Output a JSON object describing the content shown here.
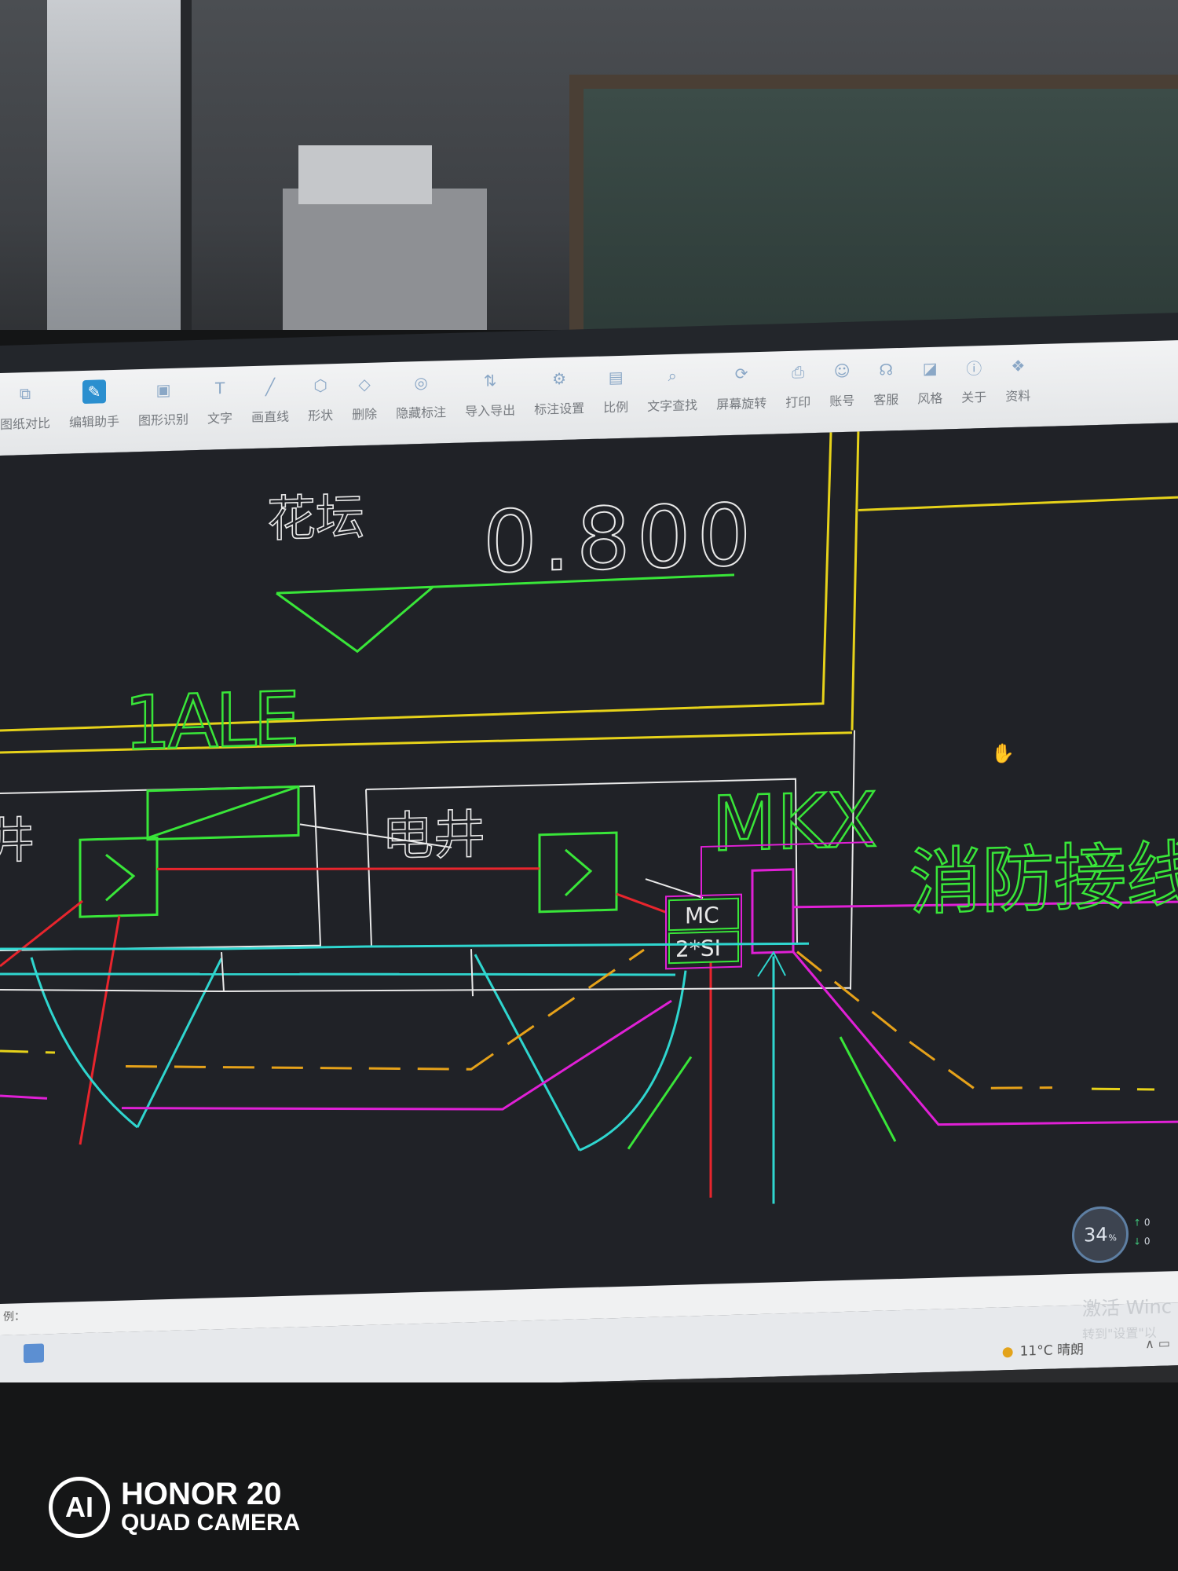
{
  "toolbar": {
    "items": [
      {
        "label": "图纸对比",
        "icon": "compare-icon"
      },
      {
        "label": "编辑助手",
        "icon": "edit-assistant-icon"
      },
      {
        "label": "图形识别",
        "icon": "shape-recognize-icon"
      },
      {
        "label": "文字",
        "icon": "text-icon"
      },
      {
        "label": "画直线",
        "icon": "line-icon"
      },
      {
        "label": "形状",
        "icon": "shape-icon"
      },
      {
        "label": "删除",
        "icon": "eraser-icon"
      },
      {
        "label": "隐藏标注",
        "icon": "hide-annotation-icon"
      },
      {
        "label": "导入导出",
        "icon": "import-export-icon"
      },
      {
        "label": "标注设置",
        "icon": "annotation-settings-icon"
      },
      {
        "label": "比例",
        "icon": "scale-icon"
      },
      {
        "label": "文字查找",
        "icon": "text-search-icon"
      },
      {
        "label": "屏幕旋转",
        "icon": "rotate-screen-icon"
      },
      {
        "label": "打印",
        "icon": "print-icon"
      },
      {
        "label": "账号",
        "icon": "account-icon"
      },
      {
        "label": "客服",
        "icon": "support-headset-icon"
      },
      {
        "label": "风格",
        "icon": "style-icon"
      },
      {
        "label": "关于",
        "icon": "info-icon"
      },
      {
        "label": "资料",
        "icon": "materials-icon"
      }
    ]
  },
  "drawing": {
    "flower_bed_label": "花坛",
    "elevation_value": "0.800",
    "panel_label": "1ALE",
    "shaft_label_left": "井",
    "shaft_label_center": "电井",
    "mkx_label": "MKX",
    "fire_box_label": "消防接线箱",
    "mc_label": "MC",
    "si_label": "2*SI",
    "colors": {
      "background": "#202227",
      "white": "#e8e8e8",
      "green": "#39e639",
      "yellow": "#e6d21a",
      "red": "#e8252d",
      "magenta": "#e020d6",
      "cyan": "#2fd6cf",
      "orange": "#e6a21a"
    }
  },
  "status": {
    "label": "例："
  },
  "taskbar": {
    "weather": "11°C 晴朗"
  },
  "perf_widget": {
    "percent": "34",
    "percent_unit": "%",
    "up": "0",
    "down": "0"
  },
  "watermark": {
    "activate_title": "激活 Winc",
    "activate_sub": "转到\"设置\"以"
  },
  "camera": {
    "badge": "AI",
    "line1": "HONOR 20",
    "line2": "QUAD CAMERA"
  }
}
